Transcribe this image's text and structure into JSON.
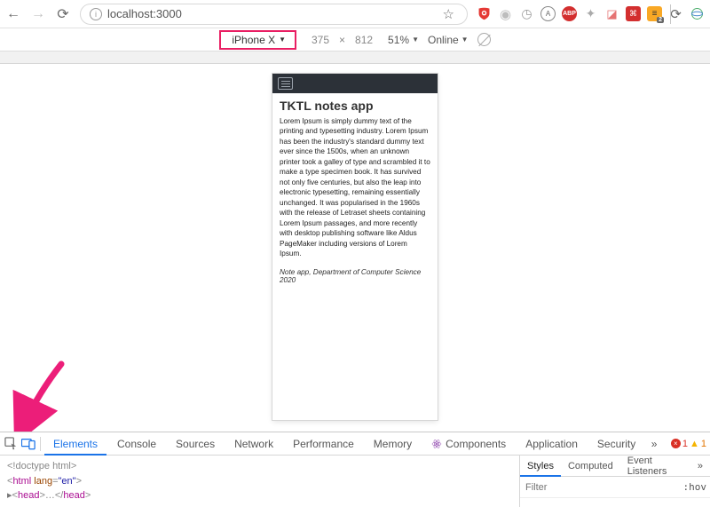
{
  "browser": {
    "url": "localhost:3000"
  },
  "extensions": {
    "yellow_badge": "2"
  },
  "device_bar": {
    "device": "iPhone X",
    "width": "375",
    "times": "×",
    "height": "812",
    "zoom": "51%",
    "network": "Online"
  },
  "page": {
    "title": "TKTL notes app",
    "body": "Lorem Ipsum is simply dummy text of the printing and typesetting industry. Lorem Ipsum has been the industry's standard dummy text ever since the 1500s, when an unknown printer took a galley of type and scrambled it to make a type specimen book. It has survived not only five centuries, but also the leap into electronic typesetting, remaining essentially unchanged. It was popularised in the 1960s with the release of Letraset sheets containing Lorem Ipsum passages, and more recently with desktop publishing software like Aldus PageMaker including versions of Lorem Ipsum.",
    "footer": "Note app, Department of Computer Science 2020"
  },
  "devtools": {
    "tabs": {
      "elements": "Elements",
      "console": "Console",
      "sources": "Sources",
      "network": "Network",
      "performance": "Performance",
      "memory": "Memory",
      "components": "Components",
      "application": "Application",
      "security": "Security"
    },
    "errors": "1",
    "warnings": "1",
    "source": {
      "doctype": "<!doctype html>",
      "html_open": "html",
      "lang_attr": "lang",
      "lang_val": "\"en\"",
      "head": "head",
      "head_close": "head"
    },
    "side": {
      "tabs": {
        "styles": "Styles",
        "computed": "Computed",
        "listeners": "Event Listeners"
      },
      "filter_placeholder": "Filter",
      "hov": ":hov"
    }
  }
}
